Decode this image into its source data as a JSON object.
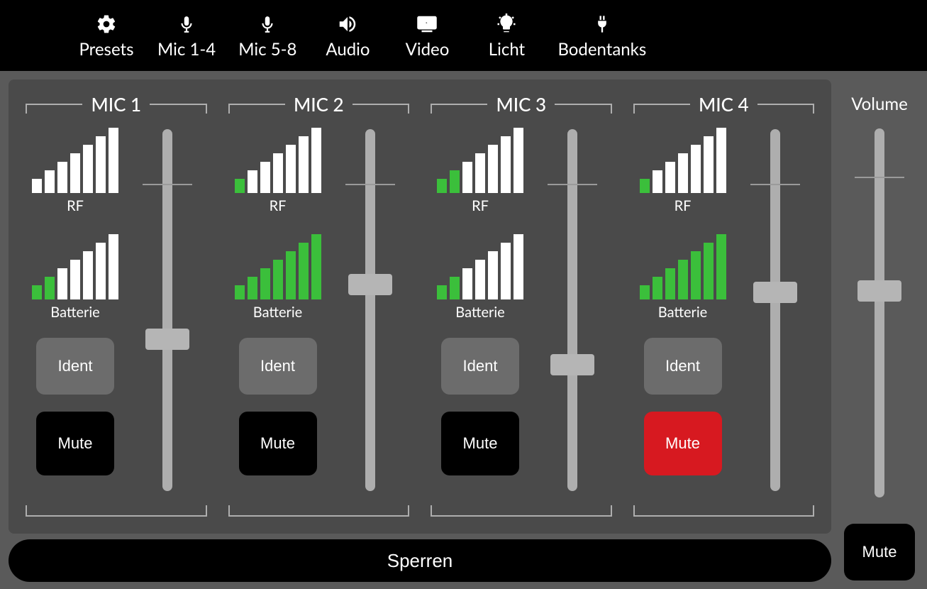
{
  "nav": [
    {
      "label": "Presets",
      "icon": "gear-icon"
    },
    {
      "label": "Mic 1-4",
      "icon": "mic-icon"
    },
    {
      "label": "Mic 5-8",
      "icon": "mic-icon"
    },
    {
      "label": "Audio",
      "icon": "speaker-icon"
    },
    {
      "label": "Video",
      "icon": "video-icon"
    },
    {
      "label": "Licht",
      "icon": "bulb-icon"
    },
    {
      "label": "Bodentanks",
      "icon": "plug-icon"
    }
  ],
  "labels": {
    "rf": "RF",
    "battery": "Batterie",
    "ident": "Ident",
    "mute": "Mute",
    "volume": "Volume",
    "lock": "Sperren"
  },
  "mics": [
    {
      "title": "MIC 1",
      "rf_green_bars": 0,
      "battery_green_bars": 2,
      "mute_active": false,
      "slider_percent": 58
    },
    {
      "title": "MIC 2",
      "rf_green_bars": 1,
      "battery_green_bars": 7,
      "mute_active": false,
      "slider_percent": 43
    },
    {
      "title": "MIC 3",
      "rf_green_bars": 2,
      "battery_green_bars": 2,
      "mute_active": false,
      "slider_percent": 65
    },
    {
      "title": "MIC 4",
      "rf_green_bars": 1,
      "battery_green_bars": 7,
      "mute_active": true,
      "slider_percent": 45
    }
  ],
  "volume": {
    "slider_percent": 44,
    "mute_active": false
  },
  "bar_heights": [
    20,
    32,
    44,
    56,
    68,
    80,
    92
  ]
}
